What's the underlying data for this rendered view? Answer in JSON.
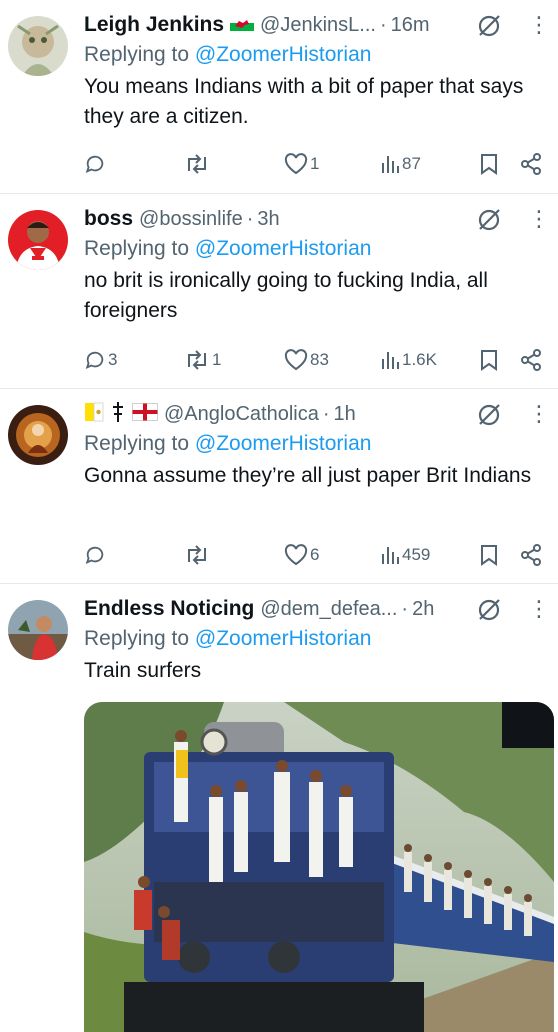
{
  "tweets": [
    {
      "name": "Leigh Jenkins",
      "handle": "@JenkinsL...",
      "dot": "·",
      "time": "16m",
      "replying_prefix": "Replying to ",
      "replying_to": "@ZoomerHistorian",
      "text": "You means Indians with a bit of paper that says they are a citizen.",
      "replies": "",
      "retweets": "",
      "likes": "1",
      "views": "87"
    },
    {
      "name": "boss",
      "handle": "@bossinlife",
      "dot": "·",
      "time": "3h",
      "replying_prefix": "Replying to ",
      "replying_to": "@ZoomerHistorian",
      "text": "no brit is ironically going to fucking India, all foreigners",
      "replies": "3",
      "retweets": "1",
      "likes": "83",
      "views": "1.6K"
    },
    {
      "name": "",
      "handle": "@AngloCatholica",
      "dot": "·",
      "time": "1h",
      "replying_prefix": "Replying to ",
      "replying_to": "@ZoomerHistorian",
      "text": "Gonna assume they’re all just paper Brit Indians",
      "replies": "",
      "retweets": "",
      "likes": "6",
      "views": "459"
    },
    {
      "name": "Endless Noticing",
      "handle": "@dem_defea...",
      "dot": "·",
      "time": "2h",
      "replying_prefix": "Replying to ",
      "replying_to": "@ZoomerHistorian",
      "text": "Train surfers"
    }
  ],
  "more_glyph": "⋮",
  "colors": {
    "accent": "#1d9bf0",
    "secondary_text": "#536471",
    "primary_text": "#0f1419"
  },
  "icons": [
    "reply-icon",
    "retweet-icon",
    "like-icon",
    "views-icon",
    "bookmark-icon",
    "share-icon",
    "grok-icon",
    "more-icon"
  ]
}
